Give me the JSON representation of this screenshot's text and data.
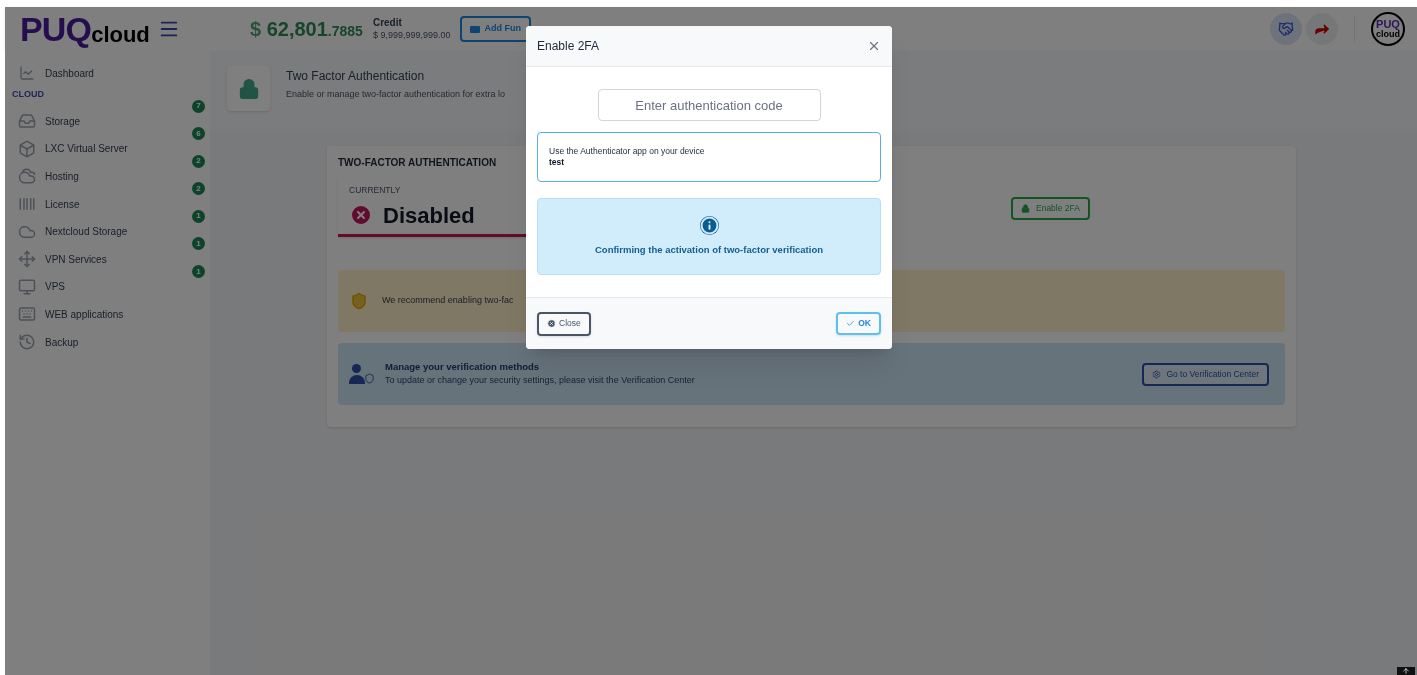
{
  "header": {
    "logo_main": "PUQ",
    "logo_sub": "cloud",
    "balance_currency": "$",
    "balance_whole": "62,801",
    "balance_fraction": ".7885",
    "credit_label": "Credit",
    "credit_value": "$ 9,999,999,999.00",
    "add_funds": "Add Fun",
    "avatar_top": "PUQ",
    "avatar_bottom": "cloud"
  },
  "sidebar": {
    "top_item": "Dashboard",
    "section_title": "CLOUD",
    "items": [
      {
        "label": "Storage",
        "badge": "7"
      },
      {
        "label": "LXC Virtual Server",
        "badge": "6"
      },
      {
        "label": "Hosting",
        "badge": "2"
      },
      {
        "label": "License",
        "badge": "2"
      },
      {
        "label": "Nextcloud Storage",
        "badge": "1"
      },
      {
        "label": "VPN Services",
        "badge": "1"
      },
      {
        "label": "VPS",
        "badge": "1"
      },
      {
        "label": "WEB applications"
      },
      {
        "label": "Backup"
      }
    ]
  },
  "page": {
    "title": "Two Factor Authentication",
    "subtitle": "Enable or manage two-factor authentication for extra lo"
  },
  "card": {
    "heading": "TWO-FACTOR AUTHENTICATION",
    "status_label": "CURRENTLY",
    "status": "Disabled",
    "enable_button": "Enable 2FA",
    "warning": "We recommend enabling two-fac",
    "manage_title": "Manage your verification methods",
    "manage_text": "To update or change your security settings, please visit the Verification Center",
    "manage_button": "Go to Verification Center"
  },
  "modal": {
    "title": "Enable 2FA",
    "code_placeholder": "Enter authentication code",
    "app_hint": "Use the Authenticator app on your device",
    "app_name": "test",
    "info": "Confirming the activation of two-factor verification",
    "close_button": "Close",
    "ok_button": "OK"
  }
}
